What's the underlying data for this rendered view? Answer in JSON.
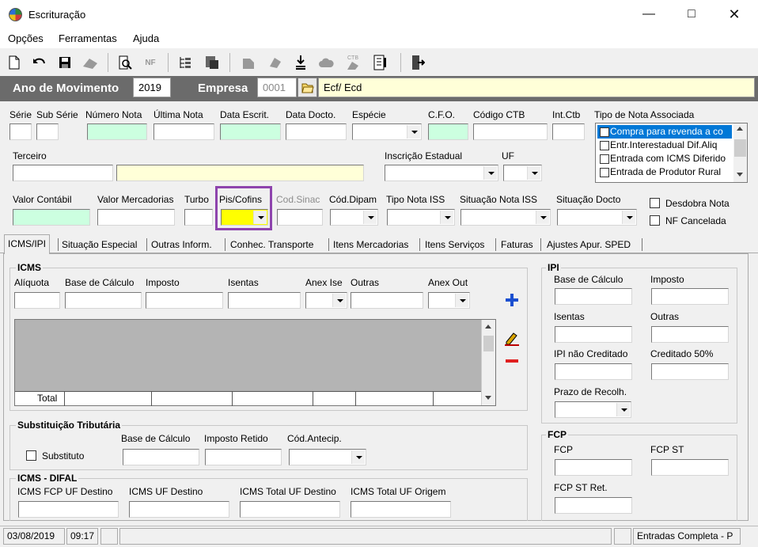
{
  "window": {
    "title": "Escrituração"
  },
  "menu": [
    "Opções",
    "Ferramentas",
    "Ajuda"
  ],
  "toolbar": {
    "icons": [
      "new-doc-icon",
      "undo-icon",
      "save-icon",
      "delete-icon",
      "print-preview-icon",
      "nfe-icon",
      "tree-icon",
      "export-icon",
      "paste-icon",
      "stamp-icon",
      "download-icon",
      "cloud-icon",
      "ctb-icon",
      "calculator-icon",
      "exit-icon"
    ]
  },
  "header": {
    "ano_label": "Ano de Movimento",
    "ano_value": "2019",
    "empresa_label": "Empresa",
    "empresa_value": "0001",
    "empresa_name": "Ecf/ Ecd"
  },
  "fields": {
    "serie": "Série",
    "sub_serie": "Sub Série",
    "numero_nota": "Número Nota",
    "ultima_nota": "Última Nota",
    "data_escrit": "Data Escrit.",
    "data_docto": "Data Docto.",
    "especie": "Espécie",
    "cfo": "C.F.O.",
    "codigo_ctb": "Código CTB",
    "int_ctb": "Int.Ctb",
    "tipo_nota": "Tipo de Nota Associada",
    "terceiro": "Terceiro",
    "inscricao": "Inscrição Estadual",
    "uf": "UF",
    "valor_contabil": "Valor Contábil",
    "valor_mercadorias": "Valor Mercadorias",
    "turbo": "Turbo",
    "pis_cofins": "Pis/Cofins",
    "cod_sinac": "Cod.Sinac",
    "cod_dipam": "Cód.Dipam",
    "tipo_nota_iss": "Tipo Nota ISS",
    "situacao_iss": "Situação Nota ISS",
    "situacao_docto": "Situação Docto",
    "desdobra": "Desdobra Nota",
    "nf_cancelada": "NF Cancelada"
  },
  "tipo_nota_items": [
    "Compra para revenda a co",
    "Entr.Interestadual Dif.Aliq",
    "Entrada com ICMS Diferido",
    "Entrada de Produtor Rural"
  ],
  "tabs": [
    "ICMS/IPI",
    "Situação Especial",
    "Outras Inform.",
    "Conhec. Transporte",
    "Itens Mercadorias",
    "Itens Serviços",
    "Faturas",
    "Ajustes Apur. SPED"
  ],
  "icms": {
    "title": "ICMS",
    "aliquota": "Alíquota",
    "base": "Base de Cálculo",
    "imposto": "Imposto",
    "isentas": "Isentas",
    "anex_ise": "Anex Ise",
    "outras": "Outras",
    "anex_out": "Anex Out",
    "total": "Total"
  },
  "st": {
    "title": "Substituição Tributária",
    "substituto": "Substituto",
    "base": "Base de Cálculo",
    "imposto_retido": "Imposto Retido",
    "cod_antecip": "Cód.Antecip."
  },
  "difal": {
    "title": "ICMS - DIFAL",
    "fcp_destino": "ICMS FCP UF Destino",
    "uf_destino": "ICMS UF Destino",
    "total_destino": "ICMS Total UF Destino",
    "total_origem": "ICMS Total UF Origem"
  },
  "ipi": {
    "title": "IPI",
    "base": "Base de Cálculo",
    "imposto": "Imposto",
    "isentas": "Isentas",
    "outras": "Outras",
    "nao_creditado": "IPI não Creditado",
    "creditado": "Creditado 50%",
    "prazo": "Prazo de Recolh."
  },
  "fcp": {
    "title": "FCP",
    "fcp": "FCP",
    "fcp_st": "FCP ST",
    "fcp_st_ret": "FCP ST Ret."
  },
  "status": {
    "date": "03/08/2019",
    "time": "09:17",
    "mode": "Entradas Completa - P"
  }
}
